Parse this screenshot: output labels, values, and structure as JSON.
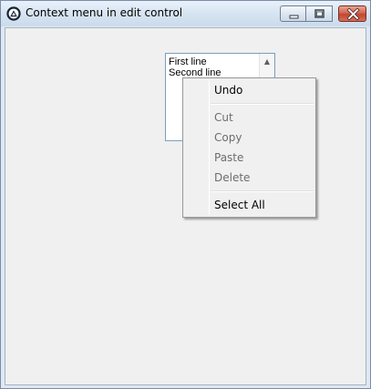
{
  "window": {
    "title": "Context menu in edit control",
    "icon": "app-logo-icon",
    "controls": {
      "minimize": "minimize-icon",
      "maximize": "maximize-icon",
      "close": "close-icon"
    }
  },
  "edit": {
    "lines": [
      "First line",
      "Second line"
    ],
    "scroll_up": "▲"
  },
  "context_menu": {
    "items": [
      {
        "label": "Undo",
        "enabled": true
      },
      {
        "label": "Cut",
        "enabled": false
      },
      {
        "label": "Copy",
        "enabled": false
      },
      {
        "label": "Paste",
        "enabled": false
      },
      {
        "label": "Delete",
        "enabled": false
      },
      {
        "label": "Select All",
        "enabled": true
      }
    ]
  },
  "colors": {
    "menu_enabled_text": "#000000",
    "menu_disabled_text": "#6d6d6d",
    "close_button": "#c24530"
  }
}
